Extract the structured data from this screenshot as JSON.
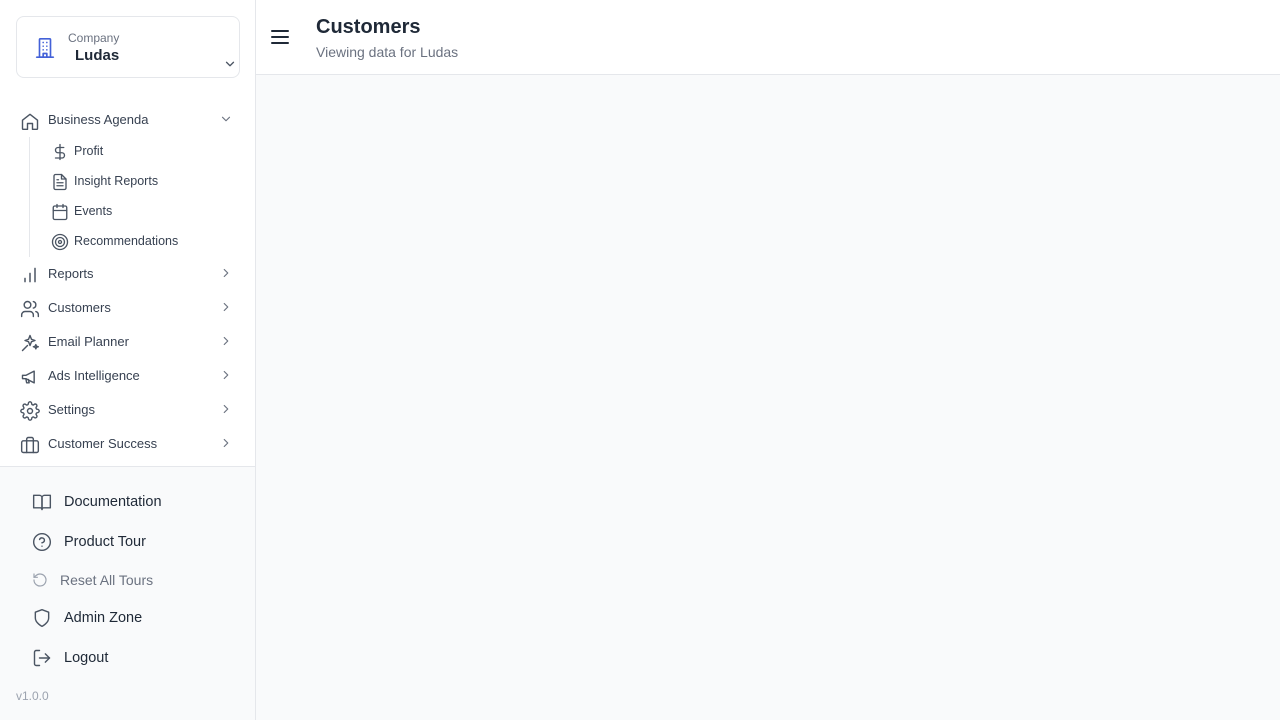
{
  "colors": {
    "accent": "#4361d8",
    "border": "#e5e7eb",
    "text": "#1f2937",
    "muted": "#6b7280"
  },
  "company": {
    "label": "Company",
    "name": "Ludas"
  },
  "nav": {
    "business_agenda": "Business Agenda",
    "sub": {
      "profit": "Profit",
      "insight_reports": "Insight Reports",
      "events": "Events",
      "recommendations": "Recommendations"
    },
    "reports": "Reports",
    "customers": "Customers",
    "email_planner": "Email Planner",
    "ads_intelligence": "Ads Intelligence",
    "settings": "Settings",
    "customer_success": "Customer Success"
  },
  "bottom": {
    "documentation": "Documentation",
    "product_tour": "Product Tour",
    "reset_tours": "Reset All Tours",
    "admin_zone": "Admin Zone",
    "logout": "Logout",
    "version": "v1.0.0"
  },
  "header": {
    "title": "Customers",
    "subtitle": "Viewing data for Ludas"
  }
}
